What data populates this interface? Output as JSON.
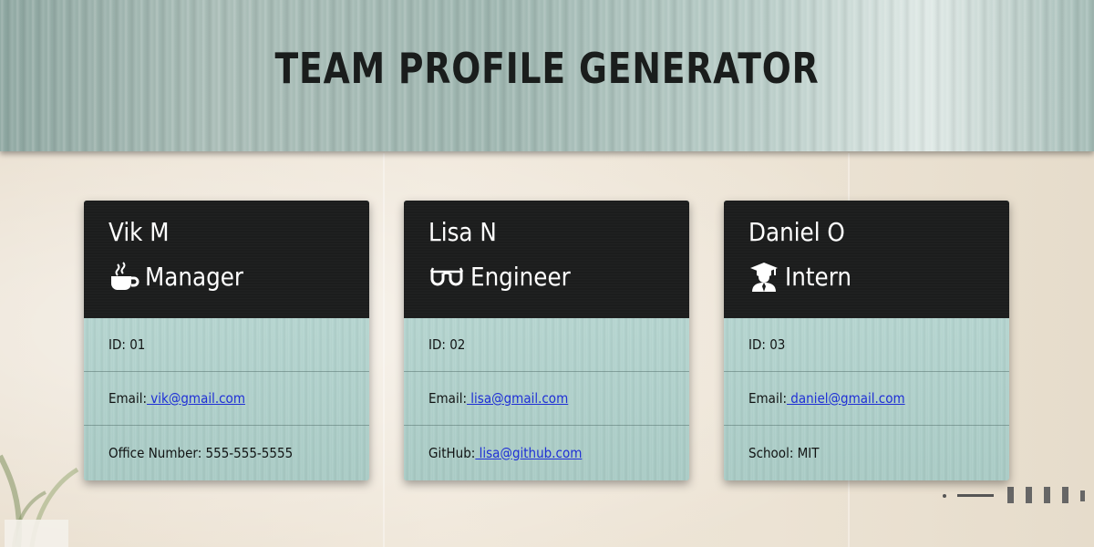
{
  "header": {
    "title": "TEAM PROFILE GENERATOR"
  },
  "cards": [
    {
      "name": "Vik M",
      "role": "Manager",
      "role_icon": "coffee-icon",
      "id_label": "ID: 01",
      "email_label": "Email:",
      "email": " vik@gmail.com",
      "extra_label": "Office Number: 555-555-5555"
    },
    {
      "name": "Lisa N",
      "role": "Engineer",
      "role_icon": "glasses-icon",
      "id_label": "ID: 02",
      "email_label": "Email:",
      "email": " lisa@gmail.com",
      "extra_label": "GitHub:",
      "extra_link": " lisa@github.com"
    },
    {
      "name": "Daniel O",
      "role": "Intern",
      "role_icon": "graduate-icon",
      "id_label": "ID: 03",
      "email_label": "Email:",
      "email": " daniel@gmail.com",
      "extra_label": "School: MIT"
    }
  ],
  "colors": {
    "card_header": "#1c1d1d",
    "card_body": "#a9cbc6",
    "link": "#1f2fd6",
    "title": "#1a1d1c"
  }
}
